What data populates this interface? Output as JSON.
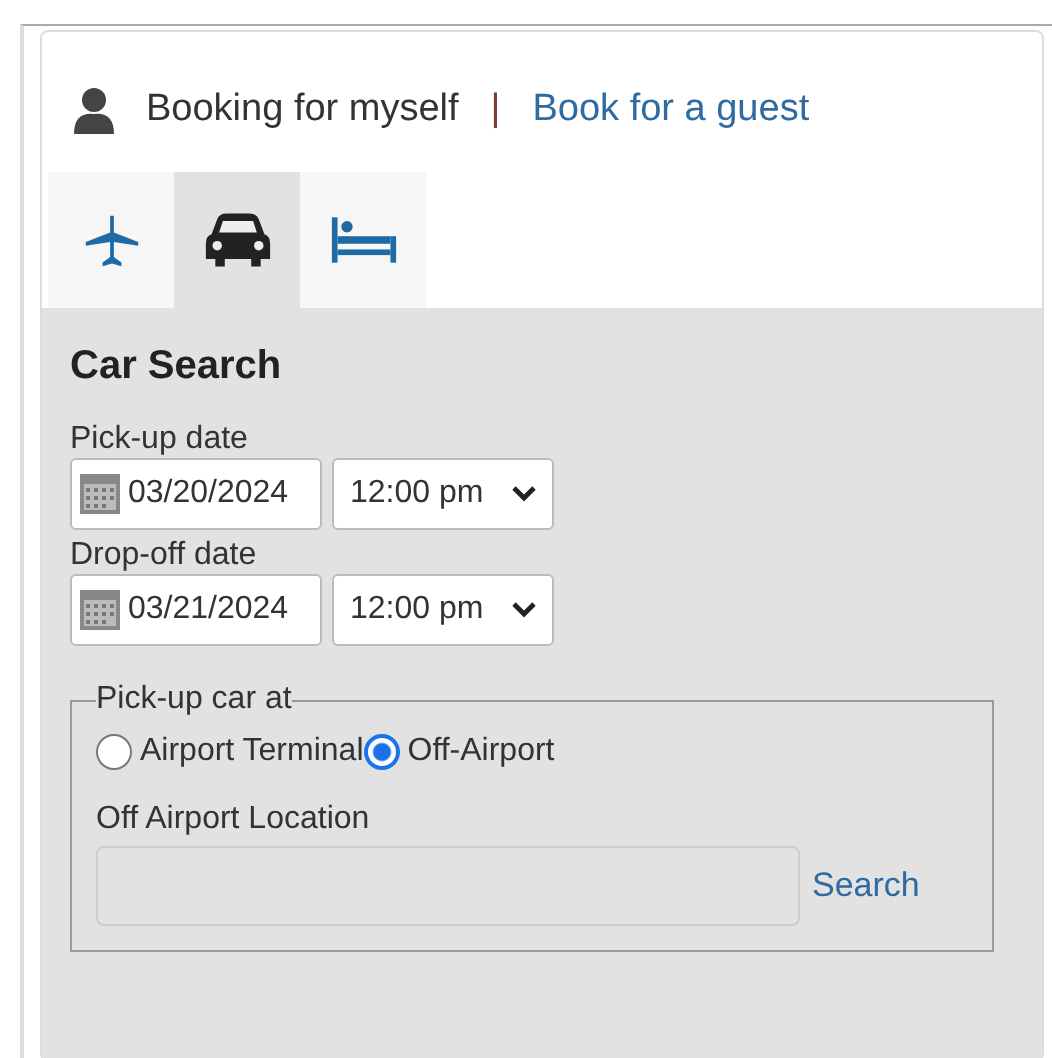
{
  "booking": {
    "self_label": "Booking for myself",
    "separator": "|",
    "guest_link": "Book for a guest"
  },
  "tabs": [
    {
      "kind": "flight",
      "selected": false
    },
    {
      "kind": "car",
      "selected": true
    },
    {
      "kind": "hotel",
      "selected": false
    }
  ],
  "panel": {
    "title": "Car Search",
    "dates": [
      {
        "label": "Pick-up date",
        "date": "03/20/2024",
        "time": "12:00 pm"
      },
      {
        "label": "Drop-off date",
        "date": "03/21/2024",
        "time": "12:00 pm"
      }
    ],
    "pickup": {
      "legend": "Pick-up car at",
      "options": [
        {
          "label": "Airport Terminal",
          "selected": false
        },
        {
          "label": "Off-Airport",
          "selected": true
        }
      ],
      "location_label": "Off Airport Location",
      "search_link": "Search"
    }
  }
}
